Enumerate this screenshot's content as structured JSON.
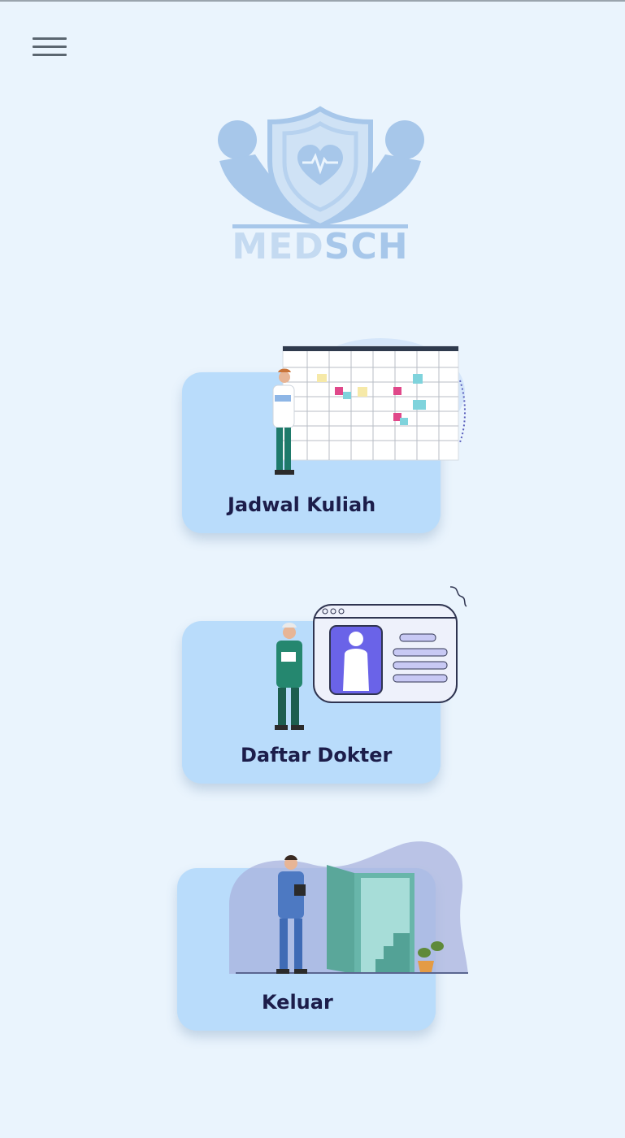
{
  "header": {
    "menu_icon": "hamburger-menu-icon"
  },
  "logo": {
    "text_part1": "MED",
    "text_part2": "SCH",
    "icon": "shield-heart-logo-icon"
  },
  "menu": {
    "items": [
      {
        "label": "Jadwal Kuliah",
        "icon": "calendar-schedule-illustration"
      },
      {
        "label": "Daftar Dokter",
        "icon": "doctor-id-card-illustration"
      },
      {
        "label": "Keluar",
        "icon": "exit-door-illustration"
      }
    ]
  },
  "colors": {
    "background": "#eaf4fd",
    "card": "#b9dcfb",
    "label": "#1c1d4a",
    "logo": "#a7c7ea"
  }
}
